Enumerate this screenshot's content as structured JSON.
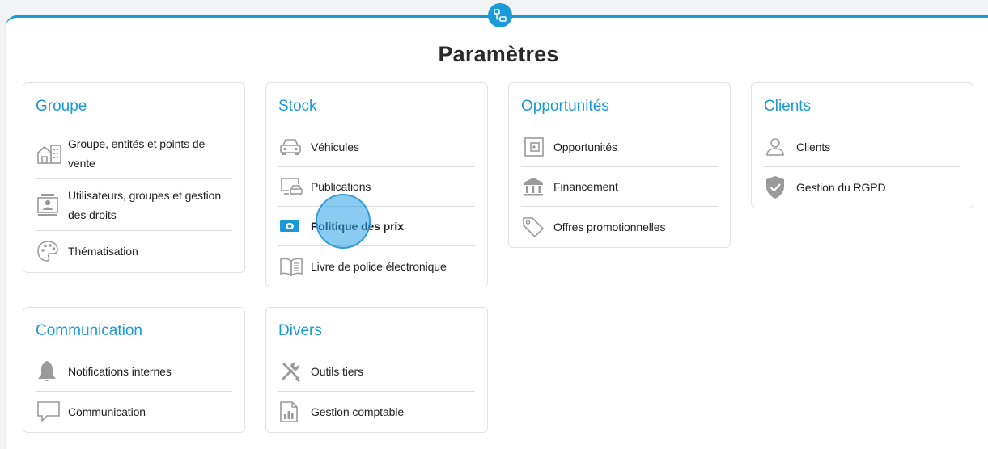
{
  "page": {
    "title": "Paramètres"
  },
  "colors": {
    "accent": "#1a9ad6",
    "icon_gray": "#9a9a9a"
  },
  "cards": {
    "groupe": {
      "title": "Groupe",
      "items": [
        {
          "label": "Groupe, entités et points de vente",
          "icon": "building-icon"
        },
        {
          "label": "Utilisateurs, groupes et gestion des droits",
          "icon": "user-badge-icon"
        },
        {
          "label": "Thématisation",
          "icon": "palette-icon"
        }
      ]
    },
    "stock": {
      "title": "Stock",
      "items": [
        {
          "label": "Véhicules",
          "icon": "car-icon"
        },
        {
          "label": "Publications",
          "icon": "monitor-car-icon"
        },
        {
          "label": "Politique des prix",
          "icon": "banknote-icon"
        },
        {
          "label": "Livre de police électronique",
          "icon": "book-icon"
        }
      ]
    },
    "opportunites": {
      "title": "Opportunités",
      "items": [
        {
          "label": "Opportunités",
          "icon": "wallet-icon"
        },
        {
          "label": "Financement",
          "icon": "bank-icon"
        },
        {
          "label": "Offres promotionnelles",
          "icon": "tag-icon"
        }
      ]
    },
    "clients": {
      "title": "Clients",
      "items": [
        {
          "label": "Clients",
          "icon": "person-icon"
        },
        {
          "label": "Gestion du RGPD",
          "icon": "shield-check-icon"
        }
      ]
    },
    "communication": {
      "title": "Communication",
      "items": [
        {
          "label": "Notifications internes",
          "icon": "bell-icon"
        },
        {
          "label": "Communication",
          "icon": "chat-bubble-icon"
        }
      ]
    },
    "divers": {
      "title": "Divers",
      "items": [
        {
          "label": "Outils tiers",
          "icon": "tools-icon"
        },
        {
          "label": "Gestion comptable",
          "icon": "accounting-chart-icon"
        }
      ]
    }
  }
}
